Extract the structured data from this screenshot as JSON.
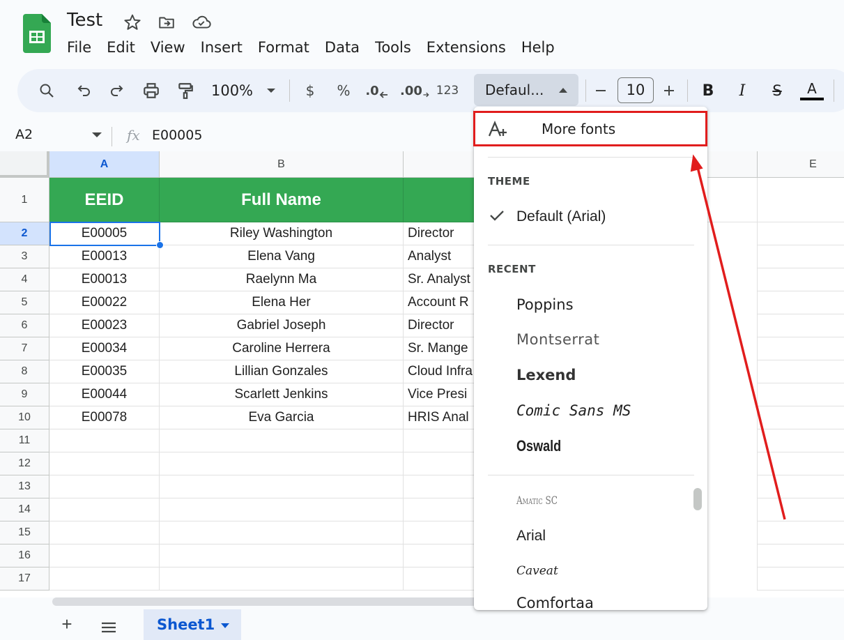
{
  "app": {
    "doc_title": "Test",
    "menu": [
      "File",
      "Edit",
      "View",
      "Insert",
      "Format",
      "Data",
      "Tools",
      "Extensions",
      "Help"
    ]
  },
  "toolbar": {
    "zoom": "100%",
    "currency": "$",
    "percent": "%",
    "decrease_decimal": ".0",
    "increase_decimal": ".00",
    "number_format": "123",
    "font_family": "Defaul...",
    "font_size": "10",
    "bold": "B",
    "italic": "I",
    "strike": "S",
    "text_color_label": "A"
  },
  "formula_bar": {
    "name_box": "A2",
    "fx": "fx",
    "value": "E00005"
  },
  "grid": {
    "columns": [
      "A",
      "B",
      "",
      "",
      "E"
    ],
    "rows": [
      "1",
      "2",
      "3",
      "4",
      "5",
      "6",
      "7",
      "8",
      "9",
      "10",
      "11",
      "12",
      "13",
      "14",
      "15",
      "16",
      "17"
    ],
    "header": {
      "a": "EEID",
      "b": "Full Name"
    },
    "data": [
      {
        "id": "E00005",
        "name": "Riley Washington",
        "title": "Director"
      },
      {
        "id": "E00013",
        "name": "Elena Vang",
        "title": "Analyst"
      },
      {
        "id": "E00013",
        "name": "Raelynn Ma",
        "title": "Sr. Analyst"
      },
      {
        "id": "E00022",
        "name": "Elena Her",
        "title": "Account R"
      },
      {
        "id": "E00023",
        "name": "Gabriel Joseph",
        "title": "Director"
      },
      {
        "id": "E00034",
        "name": "Caroline Herrera",
        "title": "Sr. Mange"
      },
      {
        "id": "E00035",
        "name": "Lillian Gonzales",
        "title": "Cloud Infra"
      },
      {
        "id": "E00044",
        "name": "Scarlett Jenkins",
        "title": "Vice Presi"
      },
      {
        "id": "E00078",
        "name": "Eva Garcia",
        "title": "HRIS Anal"
      }
    ]
  },
  "dropdown": {
    "more_fonts": "More fonts",
    "theme_label": "THEME",
    "theme_item": "Default (Arial)",
    "recent_label": "RECENT",
    "recent": [
      "Poppins",
      "Montserrat",
      "Lexend",
      "Comic Sans MS",
      "Oswald"
    ],
    "all": [
      "Amatic SC",
      "Arial",
      "Caveat",
      "Comfortaa"
    ]
  },
  "sheets": {
    "active": "Sheet1",
    "add": "+",
    "list": "≡"
  },
  "colors": {
    "header_green": "#34a853",
    "accent_blue": "#0b57d0",
    "annotation_red": "#e11d1d"
  }
}
